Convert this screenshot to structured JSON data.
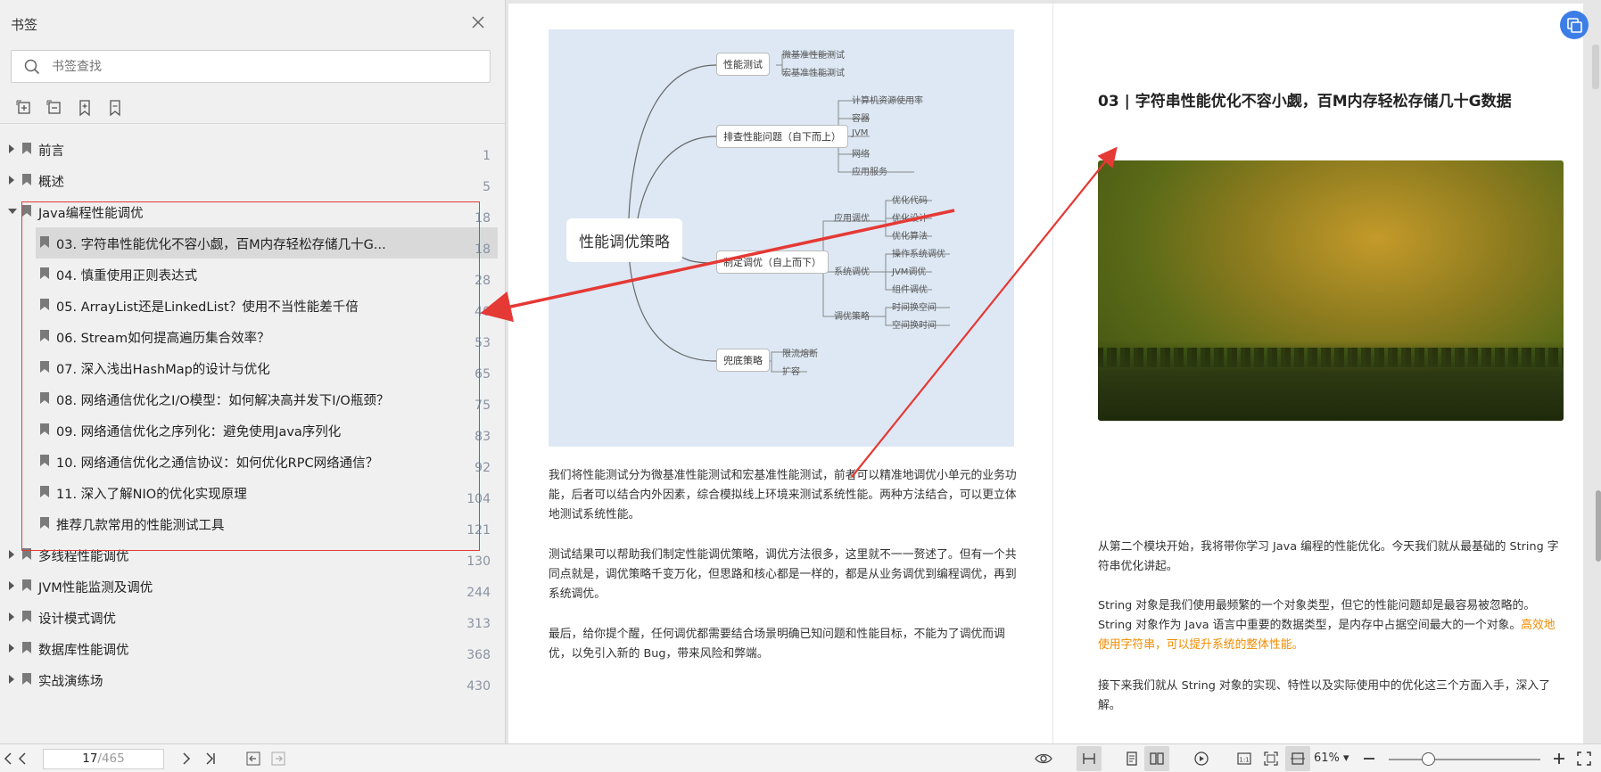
{
  "sidebar": {
    "title": "书签",
    "search_placeholder": "书签查找",
    "toc": [
      {
        "label": "前言",
        "page": "1",
        "level": 0,
        "expanded": false
      },
      {
        "label": "概述",
        "page": "5",
        "level": 0,
        "expanded": false
      },
      {
        "label": "Java编程性能调优",
        "page": "18",
        "level": 0,
        "expanded": true
      },
      {
        "label": "03. 字符串性能优化不容小觑，百M内存轻松存储几十G...",
        "page": "18",
        "level": 1,
        "selected": true
      },
      {
        "label": "04. 慎重使用正则表达式",
        "page": "28",
        "level": 1
      },
      {
        "label": "05. ArrayList还是LinkedList？使用不当性能差千倍",
        "page": "40",
        "level": 1
      },
      {
        "label": "06. Stream如何提高遍历集合效率？",
        "page": "53",
        "level": 1
      },
      {
        "label": "07. 深入浅出HashMap的设计与优化",
        "page": "65",
        "level": 1
      },
      {
        "label": "08. 网络通信优化之I/O模型：如何解决高并发下I/O瓶颈？",
        "page": "75",
        "level": 1
      },
      {
        "label": "09. 网络通信优化之序列化：避免使用Java序列化",
        "page": "83",
        "level": 1
      },
      {
        "label": "10. 网络通信优化之通信协议：如何优化RPC网络通信？",
        "page": "92",
        "level": 1
      },
      {
        "label": "11. 深入了解NIO的优化实现原理",
        "page": "104",
        "level": 1
      },
      {
        "label": "推荐几款常用的性能测试工具",
        "page": "121",
        "level": 1
      },
      {
        "label": "多线程性能调优",
        "page": "130",
        "level": 0,
        "expanded": false
      },
      {
        "label": "JVM性能监测及调优",
        "page": "244",
        "level": 0,
        "expanded": false
      },
      {
        "label": "设计模式调优",
        "page": "313",
        "level": 0,
        "expanded": false
      },
      {
        "label": "数据库性能调优",
        "page": "368",
        "level": 0,
        "expanded": false
      },
      {
        "label": "实战演练场",
        "page": "430",
        "level": 0,
        "expanded": false
      }
    ]
  },
  "left_page": {
    "mindmap": {
      "root": "性能调优策略",
      "b1": "性能测试",
      "b1_leaf1": "微基准性能测试",
      "b1_leaf2": "宏基准性能测试",
      "b2": "排查性能问题（自下而上）",
      "b2_leaf1": "计算机资源使用率",
      "b2_leaf2": "容器",
      "b2_leaf3": "JVM",
      "b2_leaf4": "网络",
      "b2_leaf5": "应用服务",
      "b3": "制定调优（自上而下）",
      "b3_mid1": "应用调优",
      "b3_m1_l1": "优化代码",
      "b3_m1_l2": "优化设计",
      "b3_m1_l3": "优化算法",
      "b3_mid2": "系统调优",
      "b3_m2_l1": "操作系统调优",
      "b3_m2_l2": "JVM调优",
      "b3_m2_l3": "组件调优",
      "b3_mid3": "调优策略",
      "b3_m3_l1": "时间换空间",
      "b3_m3_l2": "空间换时间",
      "b4": "兜底策略",
      "b4_leaf1": "限流熔断",
      "b4_leaf2": "扩容"
    },
    "para1": "我们将性能测试分为微基准性能测试和宏基准性能测试，前者可以精准地调优小单元的业务功能，后者可以结合内外因素，综合模拟线上环境来测试系统性能。两种方法结合，可以更立体地测试系统性能。",
    "para2": "测试结果可以帮助我们制定性能调优策略，调优方法很多，这里就不一一赘述了。但有一个共同点就是，调优策略千变万化，但思路和核心都是一样的，都是从业务调优到编程调优，再到系统调优。",
    "para3": "最后，给你提个醒，任何调优都需要结合场景明确已知问题和性能目标，不能为了调优而调优，以免引入新的 Bug，带来风险和弊端。"
  },
  "right_page": {
    "title": "03 | 字符串性能优化不容小觑，百M内存轻松存储几十G数据",
    "para1": "从第二个模块开始，我将带你学习 Java 编程的性能优化。今天我们就从最基础的 String 字符串优化讲起。",
    "para2_a": "String 对象是我们使用最频繁的一个对象类型，但它的性能问题却是最容易被忽略的。String 对象作为 Java 语言中重要的数据类型，是内存中占据空间最大的一个对象。",
    "para2_b": "高效地使用字符串，可以提升系统的整体性能。",
    "para3": "接下来我们就从 String 对象的实现、特性以及实际使用中的优化这三个方面入手，深入了解。"
  },
  "bottombar": {
    "current_page": "17",
    "total_pages": "/465",
    "zoom": "61%",
    "zoom_level": 0.26
  },
  "colors": {
    "annotation_red": "#e53935",
    "highlight_orange": "#f08c00",
    "float_button_blue": "#3d7ee6",
    "mindmap_bg": "#dde8f4"
  }
}
